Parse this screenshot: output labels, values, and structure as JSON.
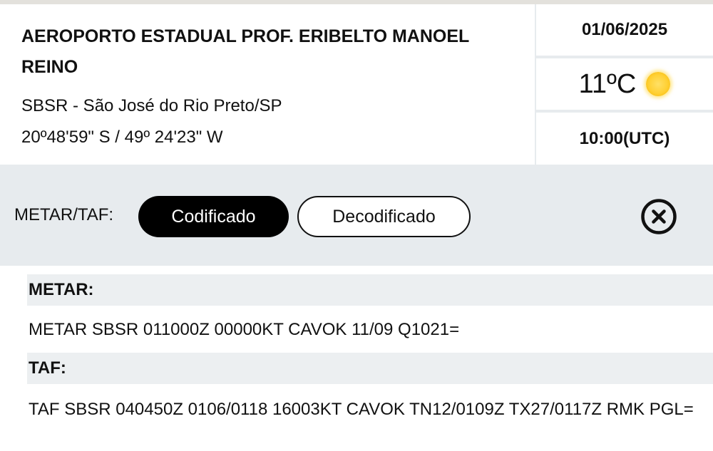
{
  "airport": {
    "name": "AEROPORTO ESTADUAL PROF. ERIBELTO MANOEL REINO",
    "location": "SBSR - São José do Rio Preto/SP",
    "coordinates": "20º48'59\" S / 49º 24'23\" W"
  },
  "weather": {
    "date": "01/06/2025",
    "temperature": "11ºC",
    "condition_icon": "sun-icon",
    "time": "10:00(UTC)"
  },
  "toolbar": {
    "label": "METAR/TAF:",
    "coded_label": "Codificado",
    "decoded_label": "Decodificado",
    "selected": "Codificado",
    "close_icon": "close-circle-icon"
  },
  "metar": {
    "heading": "METAR:",
    "text": "METAR SBSR 011000Z 00000KT CAVOK 11/09 Q1021="
  },
  "taf": {
    "heading": "TAF:",
    "text": "TAF SBSR 040450Z 0106/0118 16003KT CAVOK TN12/0109Z TX27/0117Z RMK PGL="
  },
  "colors": {
    "panel_bg": "#e7ebee",
    "selected_button": "#000000",
    "sun": "#ffd033"
  }
}
